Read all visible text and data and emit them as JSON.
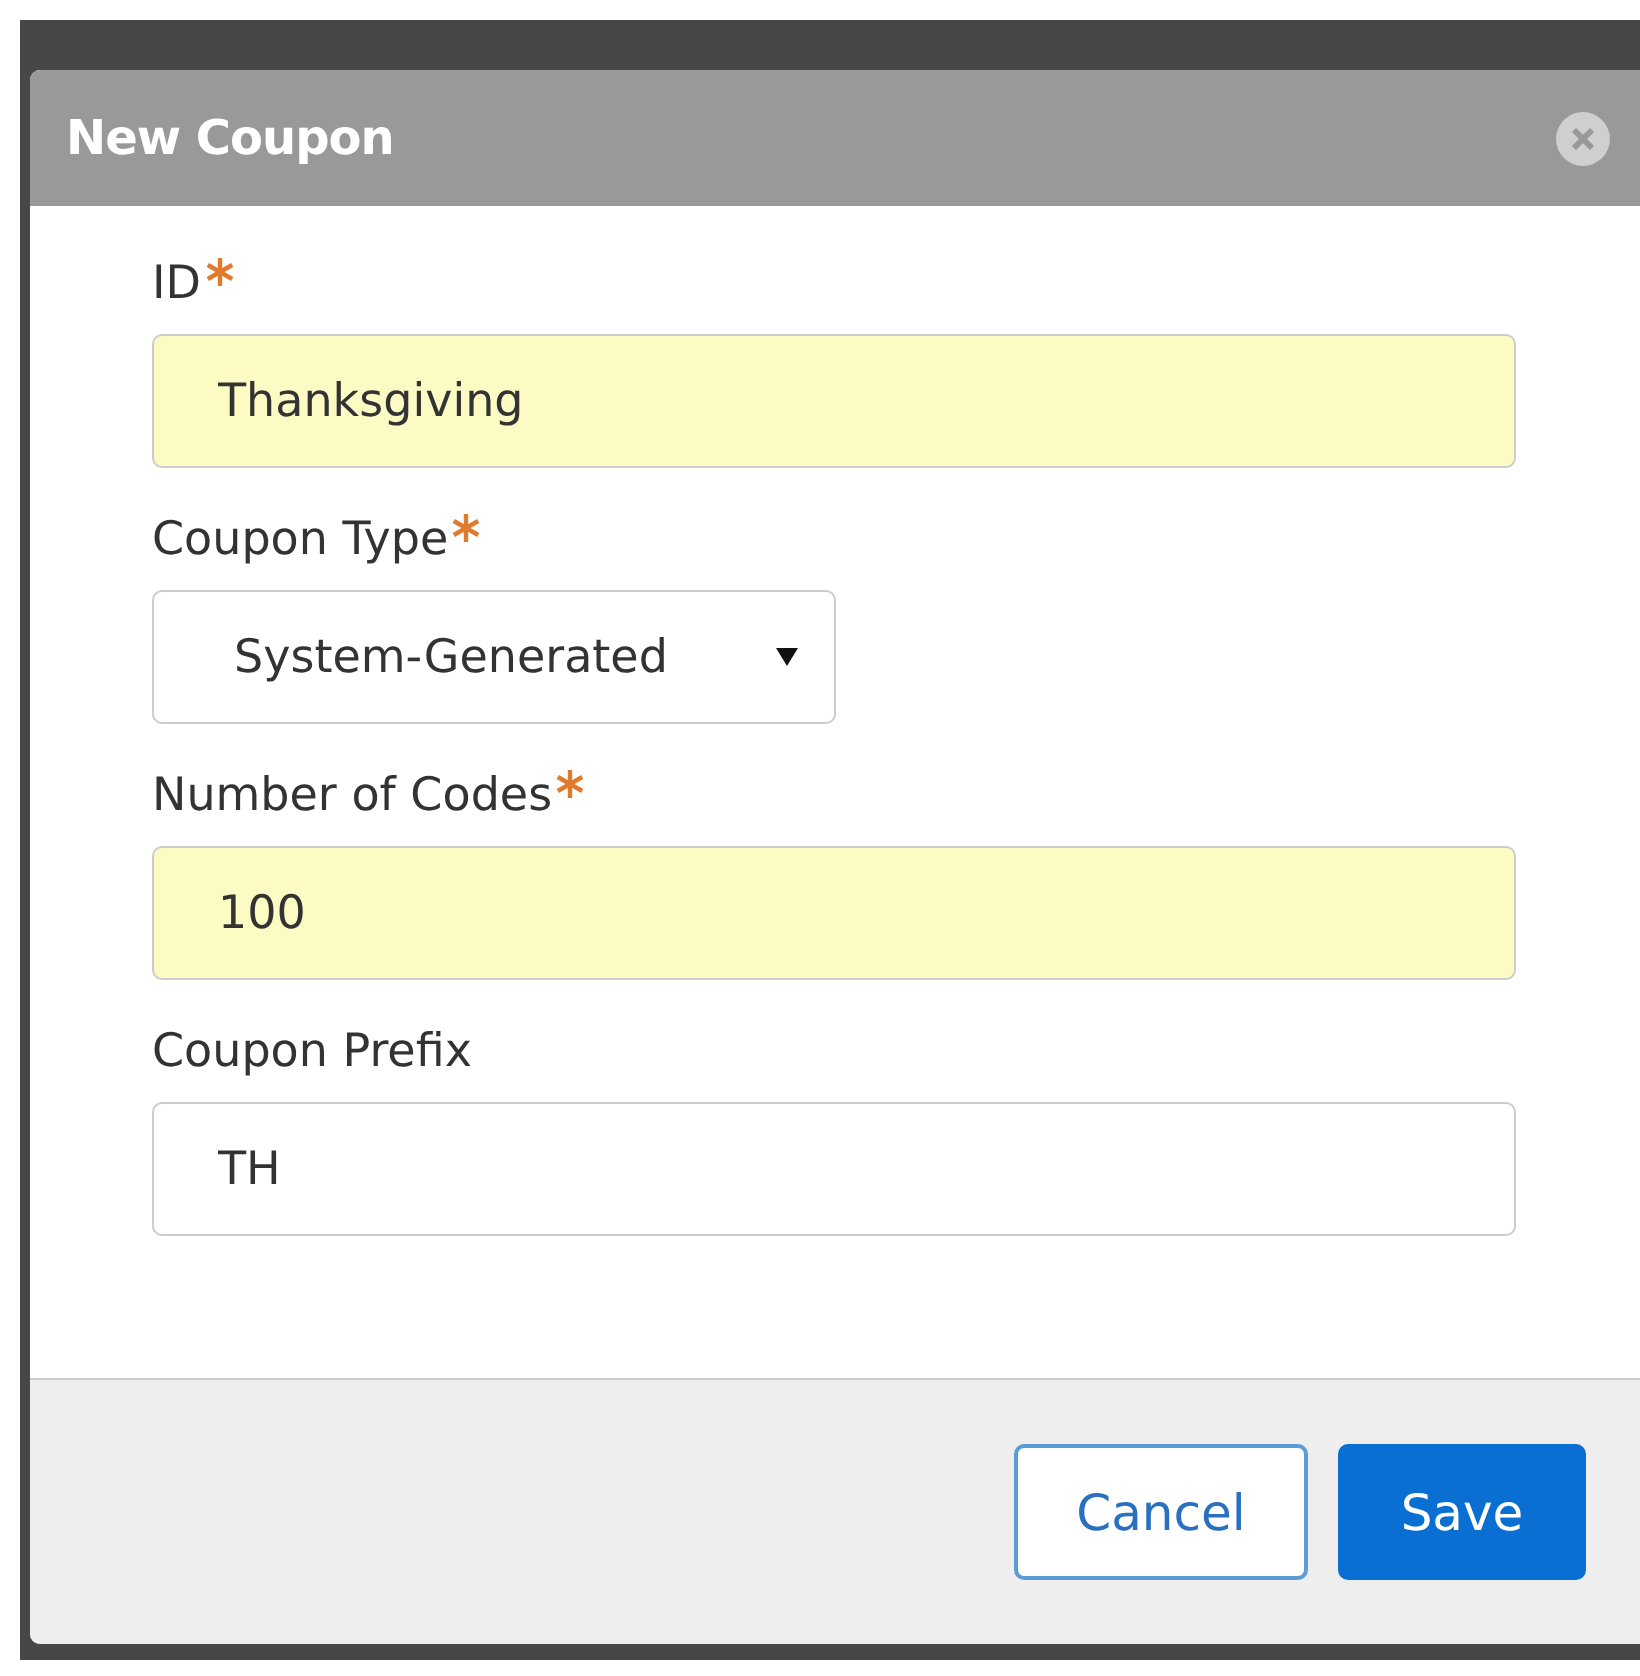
{
  "dialog": {
    "title": "New Coupon",
    "fields": [
      {
        "kind": "input",
        "label": "ID",
        "required": true,
        "highlighted": true,
        "value": "Thanksgiving"
      },
      {
        "kind": "select",
        "label": "Coupon Type",
        "required": true,
        "highlighted": false,
        "value": "System-Generated"
      },
      {
        "kind": "input",
        "label": "Number of Codes",
        "required": true,
        "highlighted": true,
        "value": "100"
      },
      {
        "kind": "input",
        "label": "Coupon Prefix",
        "required": false,
        "highlighted": false,
        "value": "TH"
      }
    ],
    "buttons": [
      {
        "label": "Cancel",
        "kind": "secondary"
      },
      {
        "label": "Save",
        "kind": "primary"
      }
    ]
  }
}
